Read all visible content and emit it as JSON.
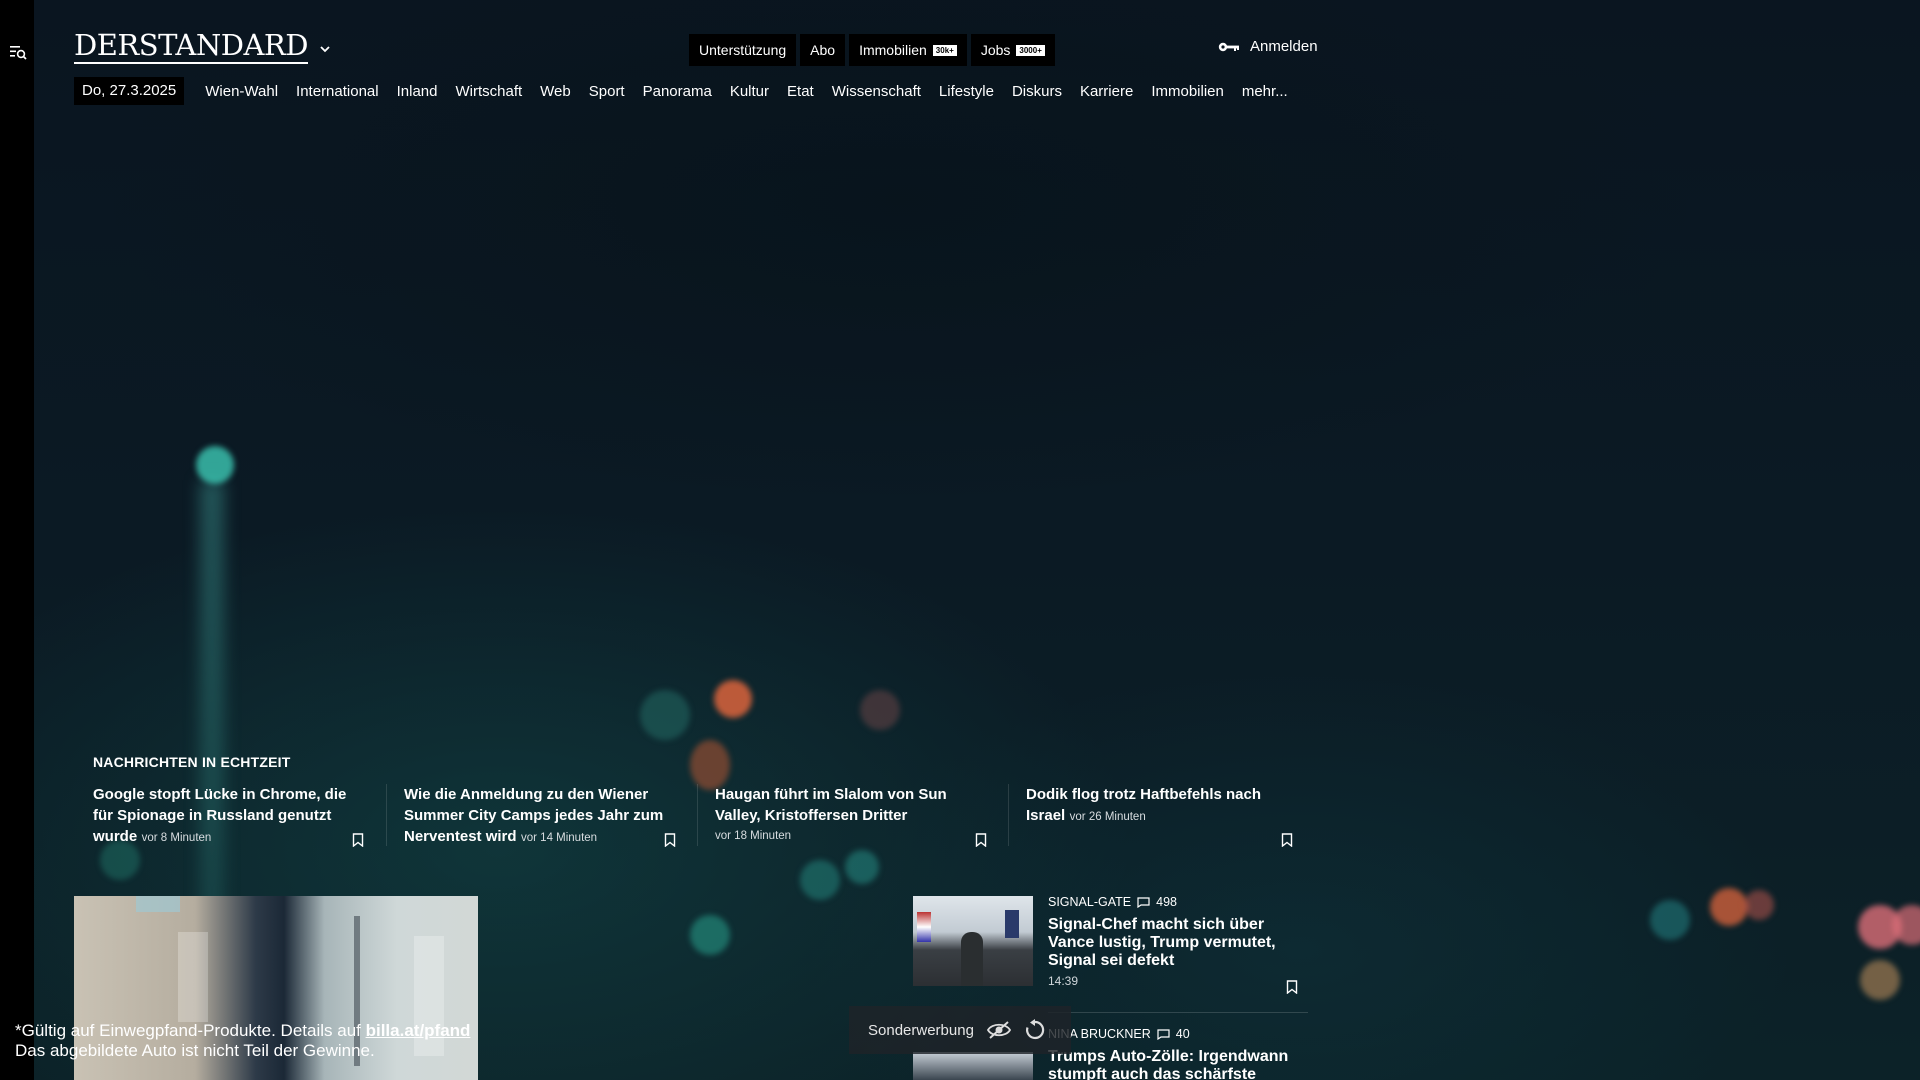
{
  "header": {
    "logo": "DERSTANDARD",
    "top_links": [
      {
        "label": "Unterstützung",
        "badge": ""
      },
      {
        "label": "Abo",
        "badge": ""
      },
      {
        "label": "Immobilien",
        "badge": "30k+"
      },
      {
        "label": "Jobs",
        "badge": "3000+"
      }
    ],
    "login_label": "Anmelden"
  },
  "nav": {
    "date": "Do, 27.3.2025",
    "items": [
      "Wien-Wahl",
      "International",
      "Inland",
      "Wirtschaft",
      "Web",
      "Sport",
      "Panorama",
      "Kultur",
      "Etat",
      "Wissenschaft",
      "Lifestyle",
      "Diskurs",
      "Karriere",
      "Immobilien",
      "mehr..."
    ]
  },
  "realtime": {
    "heading": "NACHRICHTEN IN ECHTZEIT",
    "items": [
      {
        "title": "Google stopft Lücke in Chrome, die für Spionage in Russland genutzt wurde",
        "time": "vor 8 Minuten"
      },
      {
        "title": "Wie die Anmeldung zu den Wiener Summer City Camps jedes Jahr zum Nerventest wird",
        "time": "vor 14 Minuten"
      },
      {
        "title": "Haugan führt im Slalom von Sun Valley, Kristoffersen Dritter",
        "time": "vor 18 Minuten"
      },
      {
        "title": "Dodik flog trotz Haftbefehls nach Israel",
        "time": "vor 26 Minuten"
      }
    ]
  },
  "side_articles": [
    {
      "kicker": "SIGNAL-GATE",
      "comments": "498",
      "title": "Signal-Chef macht sich über Vance lustig, Trump vermutet, Signal sei defekt",
      "time": "14:39"
    },
    {
      "kicker": "NINA BRUCKNER",
      "comments": "40",
      "title": "Trumps Auto-Zölle: Irgendwann stumpft auch das schärfste"
    }
  ],
  "legal": {
    "line1_a": "*Gültig auf Einwegpfand-Produkte. Details auf ",
    "line1_link": "billa.at/pfand",
    "line2": "Das abgebildete Auto ist nicht Teil der Gewinne."
  },
  "ad_bar": {
    "label": "Sonderwerbung"
  }
}
